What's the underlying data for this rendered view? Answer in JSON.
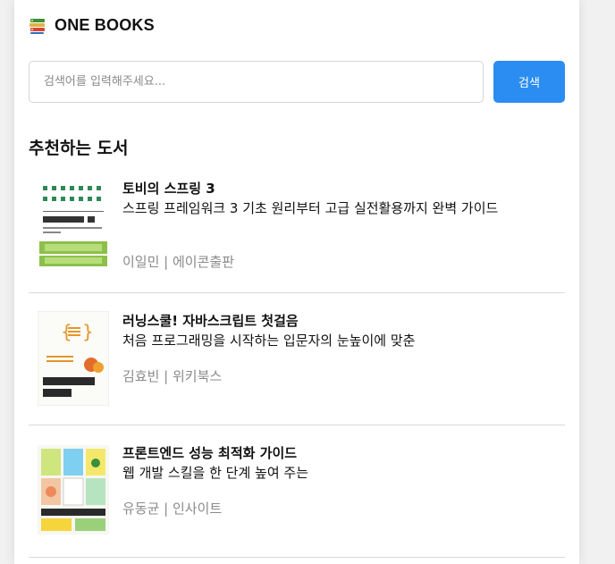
{
  "app": {
    "title": "ONE BOOKS",
    "logo_icon": "books-stack-icon"
  },
  "search": {
    "placeholder": "검색어를 입력해주세요...",
    "value": "",
    "button_label": "검색"
  },
  "recommend": {
    "heading": "추천하는 도서"
  },
  "books": [
    {
      "title": "토비의 스프링 3",
      "description": "스프링 프레임워크 3 기초 원리부터 고급 실전활용까지 완벽 가이드",
      "meta": "이일민 | 에이콘출판",
      "cover_icon": "spring-book-cover"
    },
    {
      "title": "러닝스쿨! 자바스크립트 첫걸음",
      "description": "처음 프로그래밍을 시작하는 입문자의 눈높이에 맞춘",
      "meta": "김효빈 | 위키북스",
      "cover_icon": "javascript-book-cover"
    },
    {
      "title": "프론트엔드 성능 최적화 가이드",
      "description": "웹 개발 스킬을 한 단계 높여 주는",
      "meta": "유동균 | 인사이트",
      "cover_icon": "frontend-book-cover"
    }
  ],
  "colors": {
    "accent": "#2b8df2",
    "meta_text": "#8a8a8a",
    "divider": "#d9d9d9"
  }
}
